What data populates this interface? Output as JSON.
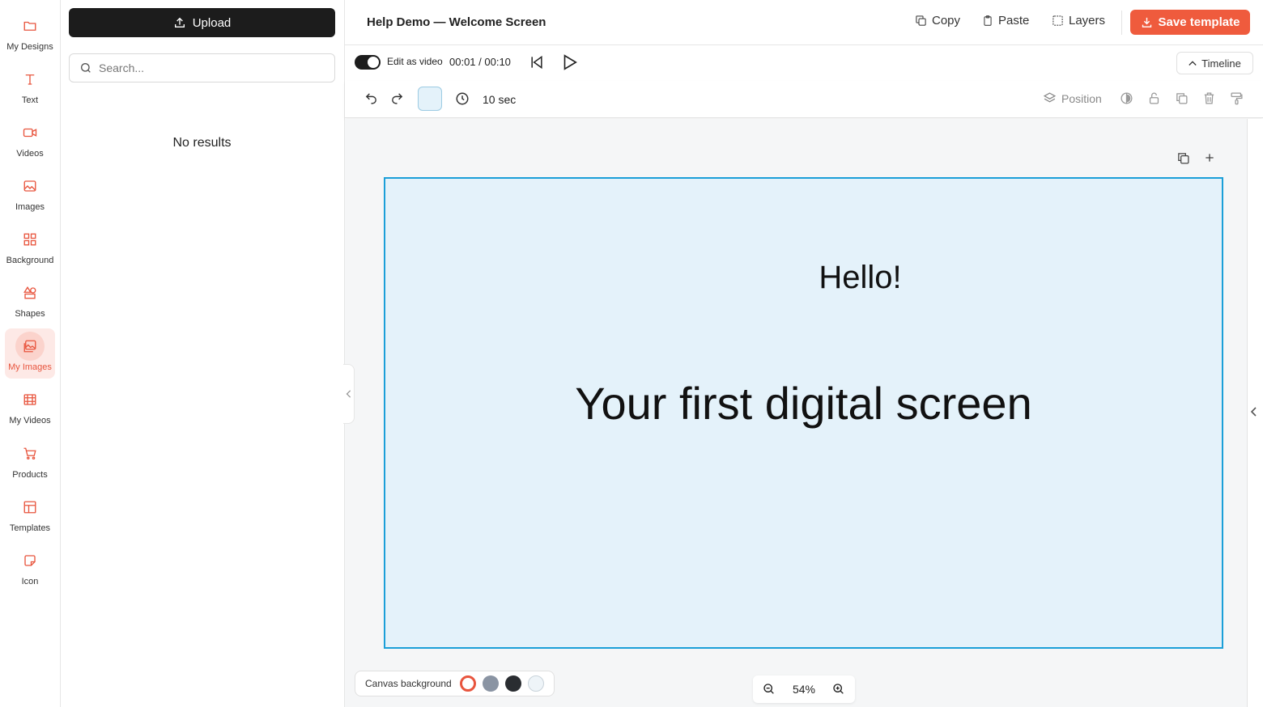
{
  "sidebar": {
    "items": [
      {
        "label": "My Designs",
        "icon": "folder-icon"
      },
      {
        "label": "Text",
        "icon": "text-icon"
      },
      {
        "label": "Videos",
        "icon": "video-camera-icon"
      },
      {
        "label": "Images",
        "icon": "image-icon"
      },
      {
        "label": "Background",
        "icon": "grid-icon"
      },
      {
        "label": "Shapes",
        "icon": "shapes-icon"
      },
      {
        "label": "My Images",
        "icon": "images-stack-icon"
      },
      {
        "label": "My Videos",
        "icon": "film-icon"
      },
      {
        "label": "Products",
        "icon": "cart-icon"
      },
      {
        "label": "Templates",
        "icon": "layout-icon"
      },
      {
        "label": "Icon",
        "icon": "sticker-icon"
      }
    ],
    "active": "My Images"
  },
  "panel": {
    "upload_label": "Upload",
    "search_placeholder": "Search...",
    "empty_text": "No results"
  },
  "header": {
    "title": "Help Demo — Welcome Screen",
    "copy_label": "Copy",
    "paste_label": "Paste",
    "layers_label": "Layers",
    "save_label": "Save template"
  },
  "video_bar": {
    "toggle_label": "Edit as video",
    "toggle_on": true,
    "time": "00:01 / 00:10",
    "timeline_label": "Timeline"
  },
  "edit_bar": {
    "duration": "10 sec",
    "position_label": "Position"
  },
  "canvas": {
    "greeting": "Hello!",
    "headline": "Your first digital screen",
    "background_color": "#e4f2fa",
    "selection_color": "#1b9fd8"
  },
  "canvas_background": {
    "label": "Canvas background",
    "colors": [
      "#ffffff",
      "#8a94a3",
      "#2a2d31",
      "#eef4f8"
    ]
  },
  "zoom": {
    "value": "54%"
  },
  "colors": {
    "accent": "#ef5b3d",
    "icon": "#e8553e"
  }
}
